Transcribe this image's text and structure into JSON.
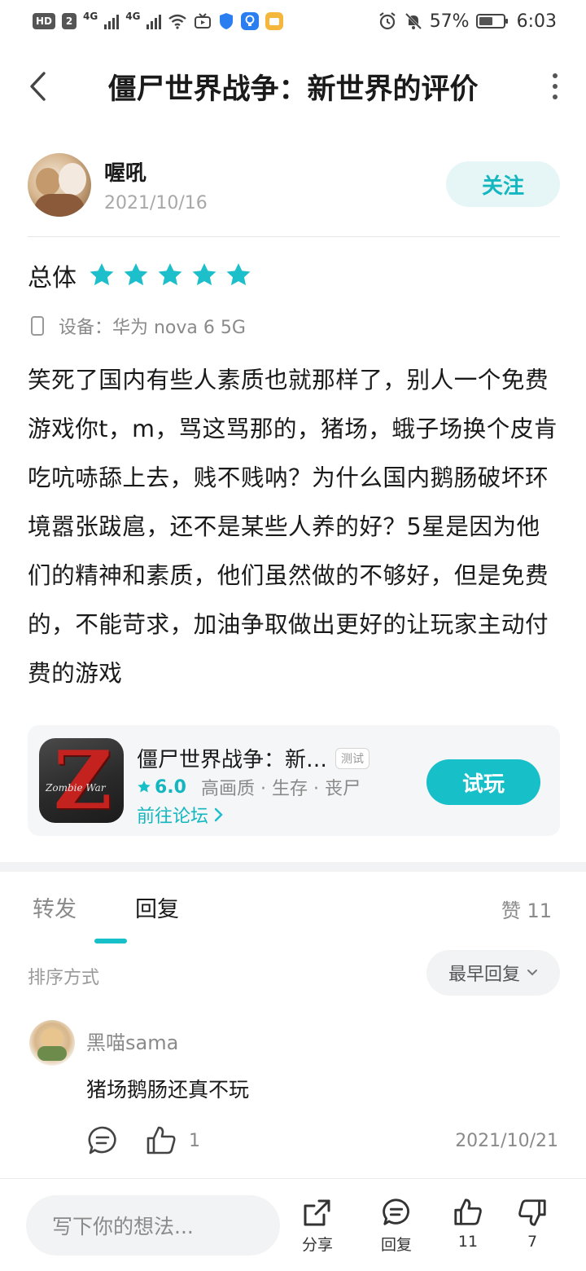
{
  "status_bar": {
    "hd_label": "HD",
    "hd_sub": "2",
    "net1": "4G",
    "net2": "4G",
    "battery_text": "57%",
    "time": "6:03"
  },
  "header": {
    "title": "僵尸世界战争：新世界的评价"
  },
  "author": {
    "name": "喔吼",
    "date": "2021/10/16",
    "follow_label": "关注"
  },
  "rating": {
    "label": "总体",
    "stars": 5,
    "star_color": "#1dbfcb"
  },
  "device": {
    "label": "设备：华为 nova 6 5G"
  },
  "review": {
    "text": "笑死了国内有些人素质也就那样了，别人一个免费游戏你t，m，骂这骂那的，猪场，蛾子场换个皮肯吃吭哧舔上去，贱不贱呐？为什么国内鹅肠破坏环境嚣张跋扈，还不是某些人养的好？5星是因为他们的精神和素质，他们虽然做的不够好，但是免费的，不能苛求，加油争取做出更好的让玩家主动付费的游戏"
  },
  "app_card": {
    "name": "僵尸世界战争：新…",
    "tag": "测试",
    "score": "6.0",
    "meta": "高画质 · 生存 · 丧尸",
    "forum_link": "前往论坛",
    "try_label": "试玩",
    "icon_letter": "Z",
    "icon_text": "Zombie War"
  },
  "tabs": [
    {
      "label": "转发"
    },
    {
      "label": "回复"
    }
  ],
  "likes_label": "赞 11",
  "sort": {
    "label": "排序方式",
    "selected": "最早回复"
  },
  "comments": [
    {
      "user": "黑喵sama",
      "text": "猪场鹅肠还真不玩",
      "likes": "1",
      "date": "2021/10/21"
    }
  ],
  "bottom_bar": {
    "input_placeholder": "写下你的想法...",
    "share_label": "分享",
    "reply_label": "回复",
    "like_count": "11",
    "dislike_count": "7"
  },
  "colors": {
    "accent": "#17bfc8",
    "follow_bg": "#e6f6f7"
  }
}
